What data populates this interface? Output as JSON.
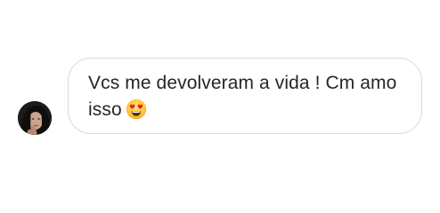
{
  "message": {
    "text": "Vcs me devolveram a vida ! Cm amo isso",
    "emoji": "heart-eyes-emoji"
  },
  "colors": {
    "bubble_border": "#dbdbdb",
    "text": "#262626",
    "background": "#ffffff"
  }
}
